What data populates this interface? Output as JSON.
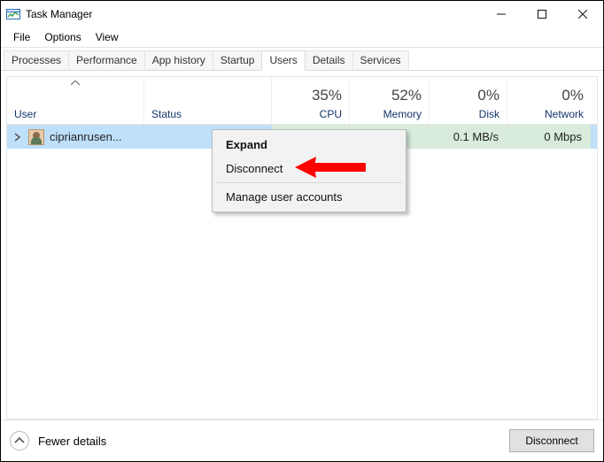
{
  "window": {
    "title": "Task Manager"
  },
  "menu": {
    "file": "File",
    "options": "Options",
    "view": "View"
  },
  "tabs": {
    "processes": "Processes",
    "performance": "Performance",
    "appHistory": "App history",
    "startup": "Startup",
    "users": "Users",
    "details": "Details",
    "services": "Services",
    "active": "users"
  },
  "columns": {
    "user": "User",
    "status": "Status",
    "cpu": {
      "value": "35%",
      "label": "CPU"
    },
    "mem": {
      "value": "52%",
      "label": "Memory"
    },
    "disk": {
      "value": "0%",
      "label": "Disk"
    },
    "net": {
      "value": "0%",
      "label": "Network"
    }
  },
  "rows": [
    {
      "name": "ciprianrusen...",
      "status": "",
      "cpu": "",
      "mem": "",
      "disk": "0.1 MB/s",
      "net": "0 Mbps",
      "selected": true
    }
  ],
  "contextMenu": {
    "expand": "Expand",
    "disconnect": "Disconnect",
    "manage": "Manage user accounts"
  },
  "footer": {
    "fewerDetails": "Fewer details",
    "disconnect": "Disconnect"
  }
}
